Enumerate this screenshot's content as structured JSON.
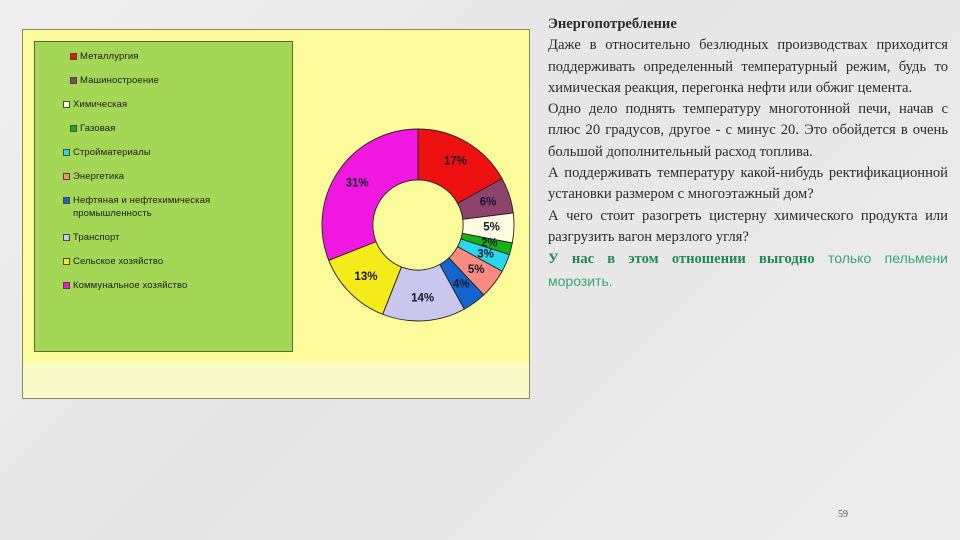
{
  "slide": {
    "page_number": "59"
  },
  "article": {
    "title": "Энергопотребление",
    "paragraphs": [
      "Даже в относительно безлюдных производствах приходится поддерживать определенный температурный режим, будь то химическая реакция, перегонка нефти или обжиг цемента.",
      "Одно дело поднять температуру многотонной печи, начав с плюс 20 градусов, другое - с минус 20. Это обойдется в очень большой дополнительный расход топлива.",
      "А поддерживать температуру какой-нибудь ректификационной установки размером с многоэтажный дом?",
      "А чего стоит разогреть цистерну химического продукта или разгрузить вагон мерзлого угля?"
    ],
    "highlight_bold": "У нас в этом отношении выгодно",
    "highlight_light": " только пельмени морозить."
  },
  "chart_data": {
    "type": "pie",
    "variant": "doughnut",
    "title": "",
    "categories": [
      "Металлургия",
      "Машиностроение",
      "Химическая",
      "Газовая",
      "Стройматериалы",
      "Энергетика",
      "Нефтяная и нефтехимическая\nпромышленность",
      "Транспорт",
      "Сельское хозяйство",
      "Коммунальное хозяйство"
    ],
    "values": [
      17,
      6,
      5,
      2,
      3,
      5,
      4,
      14,
      13,
      31
    ],
    "labels": [
      "17%",
      "6%",
      "5%",
      "2%",
      "3%",
      "5%",
      "4%",
      "14%",
      "13%",
      "31%"
    ],
    "colors": [
      "#ee1111",
      "#8d436c",
      "#fdfde4",
      "#12b512",
      "#28d9ec",
      "#fa8b80",
      "#1464cd",
      "#c9c7ee",
      "#f5ea1a",
      "#f018e0"
    ],
    "start_angle_deg": 0,
    "direction": "clockwise",
    "inner_radius_ratio": 0.47,
    "legend_position": "left",
    "grid": false
  },
  "legend": {
    "items": [
      {
        "label": "Металлургия",
        "color": "#ee1111"
      },
      {
        "label": "Машиностроение",
        "color": "#8d436c"
      },
      {
        "label": "Химическая",
        "color": "#fdfde4"
      },
      {
        "label": "Газовая",
        "color": "#12b512"
      },
      {
        "label": "Стройматериалы",
        "color": "#28d9ec"
      },
      {
        "label": "Энергетика",
        "color": "#fa8b80"
      },
      {
        "label": "Нефтяная и нефтехимическая\nпромышленность",
        "color": "#1464cd"
      },
      {
        "label": "Транспорт",
        "color": "#c9c7ee"
      },
      {
        "label": "Сельское хозяйство",
        "color": "#f5ea1a"
      },
      {
        "label": "Коммунальное хозяйство",
        "color": "#f018e0"
      }
    ]
  },
  "colors": {
    "panel_background": "#fbfb9b",
    "panel_footer": "#fbfbc9",
    "legend_background": "#a3d755",
    "accent_green": "#1f8a4c",
    "accent_green_light": "#37a972"
  }
}
